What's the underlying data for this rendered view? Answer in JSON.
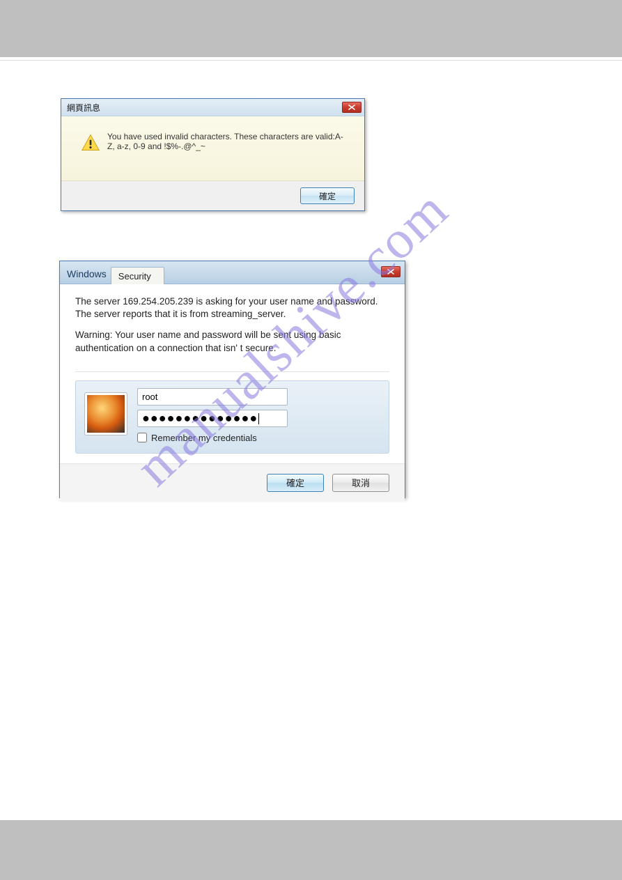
{
  "watermark": "manualshive.com",
  "dialog1": {
    "title": "網頁訊息",
    "message": "You have used invalid characters. These characters are valid:A-Z, a-z, 0-9 and !$%-.@^_~",
    "ok_label": "確定"
  },
  "dialog2": {
    "title_prefix": "Windows",
    "title_tab": "Security",
    "msg_line1": "The server 169.254.205.239 is asking for your user name and password. The server reports that it is from streaming_server.",
    "msg_line2": "Warning: Your user name and password will be sent using basic authentication on a connection that isn' t secure.",
    "username_value": "root",
    "password_masked": "●●●●●●●●●●●●●●",
    "remember_label": "Remember my credentials",
    "ok_label": "確定",
    "cancel_label": "取消"
  }
}
